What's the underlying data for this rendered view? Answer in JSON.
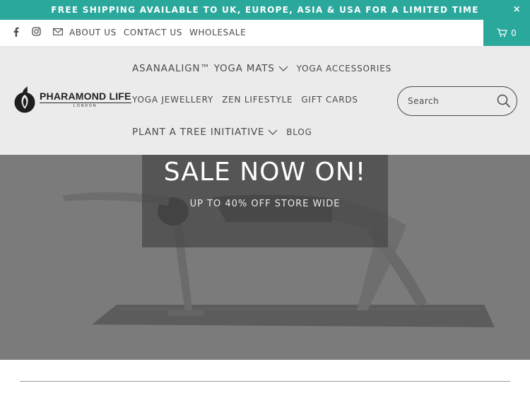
{
  "announcement": {
    "text": "FREE SHIPPING AVAILABLE TO UK, EUROPE, ASIA & USA FOR A LIMITED TIME",
    "close": "×"
  },
  "topbar": {
    "links": [
      "ABOUT US",
      "CONTACT US",
      "WHOLESALE"
    ],
    "cart_count": "0",
    "icons": [
      "facebook-icon",
      "instagram-icon",
      "mail-icon",
      "cart-icon"
    ]
  },
  "logo": {
    "main": "PHARAMOND LIFE",
    "sub": "LONDON"
  },
  "nav": {
    "row1": [
      "ASANAALIGN™ YOGA MATS",
      "YOGA ACCESSORIES"
    ],
    "row2": [
      "YOGA JEWELLERY",
      "ZEN LIFESTYLE",
      "GIFT CARDS"
    ],
    "row3": [
      "PLANT A TREE INITIATIVE",
      "BLOG"
    ]
  },
  "search": {
    "placeholder": "Search"
  },
  "hero": {
    "title": "SALE NOW ON!",
    "subtitle": "UP TO 40% OFF STORE WIDE"
  },
  "colors": {
    "accent": "#2aa89c",
    "header_bg": "#ebebeb"
  }
}
